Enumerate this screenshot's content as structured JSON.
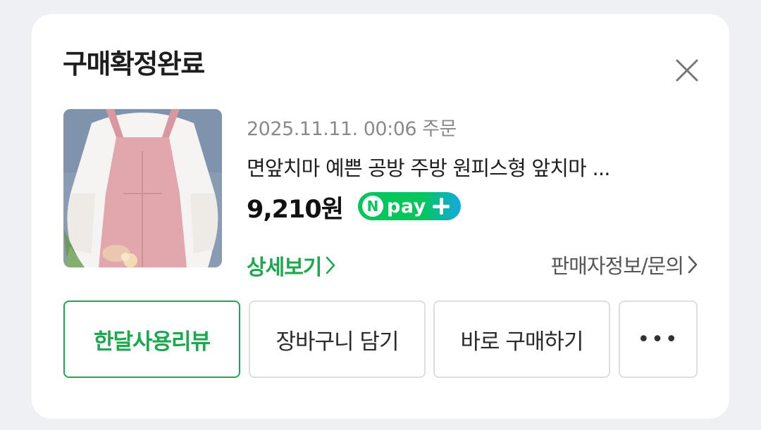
{
  "card": {
    "title": "구매확정완료",
    "close_icon": "close-icon"
  },
  "product": {
    "image_icon": "product-thumbnail",
    "order_date": "2025.11.11. 00:06 주문",
    "name": "면앞치마 예쁜 공방 주방 원피스형 앞치마 ...",
    "price": "9,210원",
    "npay": {
      "n": "N",
      "label": "pay",
      "icon": "plus-icon"
    },
    "detail_link": "상세보기",
    "seller_link": "판매자정보/문의"
  },
  "actions": {
    "review": "한달사용리뷰",
    "cart": "장바구니 담기",
    "buy_now": "바로 구매하기",
    "more": "•••"
  },
  "colors": {
    "accent_green": "#1ca84d",
    "npay_green": "#03c75a",
    "npay_blue": "#13a8e0"
  }
}
